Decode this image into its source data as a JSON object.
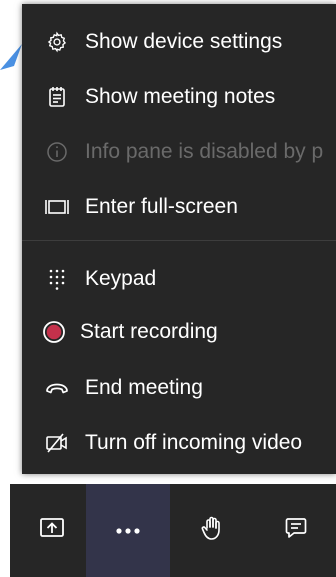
{
  "menu": {
    "items": [
      {
        "label": "Show device settings",
        "icon": "gear-icon",
        "enabled": true
      },
      {
        "label": "Show meeting notes",
        "icon": "notes-icon",
        "enabled": true
      },
      {
        "label": "Info pane is disabled by p",
        "icon": "info-icon",
        "enabled": false
      },
      {
        "label": "Enter full-screen",
        "icon": "fullscreen-icon",
        "enabled": true
      },
      {
        "label": "Keypad",
        "icon": "keypad-icon",
        "enabled": true
      },
      {
        "label": "Start recording",
        "icon": "record-icon",
        "enabled": true
      },
      {
        "label": "End meeting",
        "icon": "hang-up-icon",
        "enabled": true
      },
      {
        "label": "Turn off incoming video",
        "icon": "video-off-icon",
        "enabled": true
      }
    ]
  },
  "toolbar": {
    "buttons": [
      {
        "icon": "share-screen-icon"
      },
      {
        "icon": "more-options-icon",
        "active": true
      },
      {
        "icon": "raise-hand-icon"
      },
      {
        "icon": "chat-icon"
      }
    ]
  },
  "colors": {
    "menu_bg": "#262626",
    "text": "#ffffff",
    "disabled_text": "#6a6a6a",
    "record_red": "#c4314b",
    "active_bg": "#33344a",
    "pointer": "#4a90e2"
  }
}
